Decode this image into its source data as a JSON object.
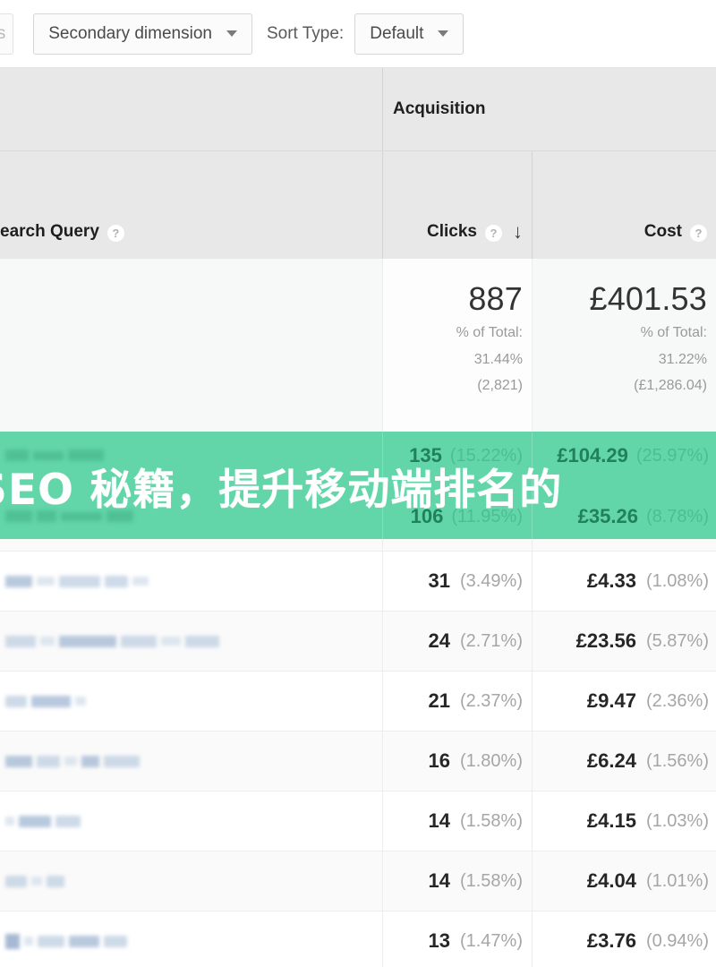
{
  "toolbar": {
    "rows_chip_label": "ws",
    "secondary_dimension_label": "Secondary dimension",
    "sort_type_label": "Sort Type:",
    "sort_type_value": "Default",
    "caret_icon": "chevron-down-icon"
  },
  "table": {
    "group_headers": {
      "acquisition": "Acquisition"
    },
    "columns": {
      "dimension": "earch Query",
      "clicks": "Clicks",
      "cost": "Cost"
    },
    "help_icon_glyph": "?",
    "sort_arrow_glyph": "↓",
    "sort_column": "Clicks",
    "summary": {
      "dimension": "",
      "clicks": {
        "value": "887",
        "of_total_label": "% of Total:",
        "of_total_pct": "31.44%",
        "of_total_abs": "(2,821)"
      },
      "cost": {
        "value": "£401.53",
        "of_total_label": "% of Total:",
        "of_total_pct": "31.22%",
        "of_total_abs": "(£1,286.04)"
      }
    },
    "rows": [
      {
        "query": "[redacted]",
        "clicks": "135",
        "clicks_pct": "(15.22%)",
        "cost": "£104.29",
        "cost_pct": "(25.97%)",
        "obscured": true
      },
      {
        "query": "[redacted]",
        "clicks": "106",
        "clicks_pct": "(11.95%)",
        "cost": "£35.26",
        "cost_pct": "(8.78%)",
        "obscured": true
      },
      {
        "query": "[redacted]",
        "clicks": "31",
        "clicks_pct": "(3.49%)",
        "cost": "£4.33",
        "cost_pct": "(1.08%)",
        "obscured": false
      },
      {
        "query": "[redacted]",
        "clicks": "24",
        "clicks_pct": "(2.71%)",
        "cost": "£23.56",
        "cost_pct": "(5.87%)",
        "obscured": false
      },
      {
        "query": "[redacted]",
        "clicks": "21",
        "clicks_pct": "(2.37%)",
        "cost": "£9.47",
        "cost_pct": "(2.36%)",
        "obscured": false
      },
      {
        "query": "[redacted]",
        "clicks": "16",
        "clicks_pct": "(1.80%)",
        "cost": "£6.24",
        "cost_pct": "(1.56%)",
        "obscured": false
      },
      {
        "query": "[redacted]",
        "clicks": "14",
        "clicks_pct": "(1.58%)",
        "cost": "£4.15",
        "cost_pct": "(1.03%)",
        "obscured": false
      },
      {
        "query": "[redacted]",
        "clicks": "14",
        "clicks_pct": "(1.58%)",
        "cost": "£4.04",
        "cost_pct": "(1.01%)",
        "obscured": false
      },
      {
        "query": "[redacted]",
        "clicks": "13",
        "clicks_pct": "(1.47%)",
        "cost": "£3.76",
        "cost_pct": "(0.94%)",
        "obscured": false
      }
    ]
  },
  "banner": {
    "text": "SEO 秘籍，提升移动端排名的",
    "background_color": "#62d5a9",
    "text_color": "#ffffff"
  },
  "colors": {
    "header_bg": "#e8e8e8",
    "summary_bg": "#f7f8f8",
    "row_border": "#ededed",
    "accent_green": "#62d5a9",
    "redaction_blue": "#a9bdd6"
  }
}
